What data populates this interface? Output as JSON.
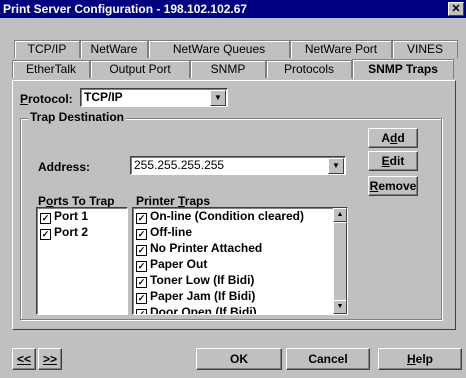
{
  "window": {
    "title": "Print Server Configuration - 198.102.102.67",
    "close_glyph": "✕"
  },
  "tabs_row1": [
    "TCP/IP",
    "NetWare",
    "NetWare Queues",
    "NetWare Port",
    "VINES"
  ],
  "tabs_row2": [
    "EtherTalk",
    "Output Port",
    "SNMP",
    "Protocols",
    "SNMP Traps"
  ],
  "active_tab": "SNMP Traps",
  "protocol": {
    "label_prefix": "P",
    "label_rest": "rotocol:",
    "value": "TCP/IP"
  },
  "trap_destination": {
    "title": "Trap Destination",
    "address_label": "Address:",
    "address_value": "255.255.255.255"
  },
  "buttons": {
    "add_a": "A",
    "add_u": "d",
    "add_b": "d",
    "edit_u": "E",
    "edit_rest": "dit",
    "remove_u": "R",
    "remove_rest": "emove"
  },
  "ports": {
    "label_a": "P",
    "label_u": "o",
    "label_b": "rts To Trap",
    "items": [
      "Port 1",
      "Port 2"
    ]
  },
  "printer_traps": {
    "label_a": "Printer ",
    "label_u": "T",
    "label_b": "raps",
    "items": [
      "On-line (Condition cleared)",
      "Off-line",
      "No Printer Attached",
      "Paper Out",
      "Toner Low (If Bidi)",
      "Paper Jam (If Bidi)",
      "Door Open (If Bidi)"
    ]
  },
  "footer": {
    "prev_label": "<<",
    "next_label": ">>",
    "ok_label": "OK",
    "cancel_label": "Cancel",
    "help_u": "H",
    "help_rest": "elp"
  }
}
